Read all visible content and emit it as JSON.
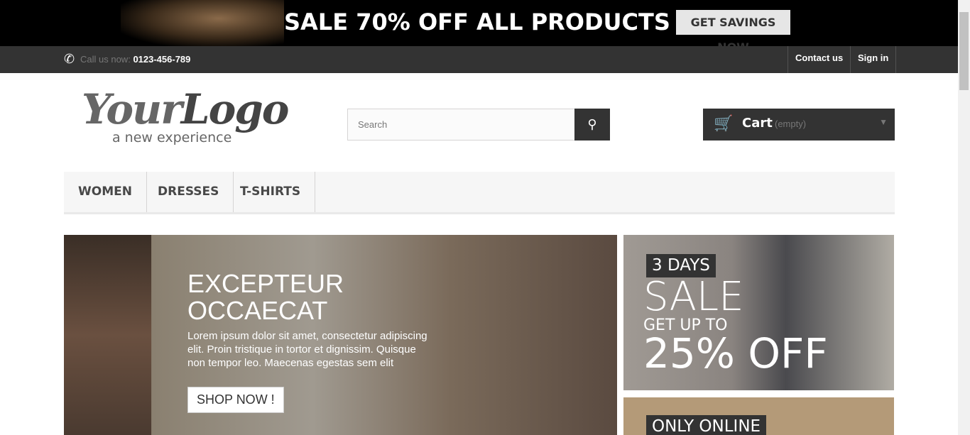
{
  "banner": {
    "text": "SALE 70% OFF ALL PRODUCTS",
    "button": "GET SAVINGS NOW"
  },
  "nav": {
    "call_label": "Call us now:",
    "phone": "0123-456-789",
    "contact": "Contact us",
    "signin": "Sign in"
  },
  "logo": {
    "text_a": "Your",
    "text_b": "Logo",
    "tagline": "a new experience"
  },
  "search": {
    "placeholder": "Search"
  },
  "cart": {
    "label": "Cart",
    "status": "(empty)"
  },
  "menu": [
    {
      "label": "WOMEN"
    },
    {
      "label": "DRESSES"
    },
    {
      "label": "T-SHIRTS"
    }
  ],
  "slider": {
    "heading": "EXCEPTEUR OCCAECAT",
    "text": "Lorem ipsum dolor sit amet, consectetur adipiscing elit. Proin tristique in tortor et dignissim. Quisque non tempor leo. Maecenas egestas sem elit",
    "button": "SHOP NOW !"
  },
  "banner1": {
    "tag": "3 DAYS",
    "sale": "SALE",
    "sub": "GET UP TO",
    "off": "25% OFF"
  },
  "banner2": {
    "tag": "ONLY ONLINE"
  }
}
